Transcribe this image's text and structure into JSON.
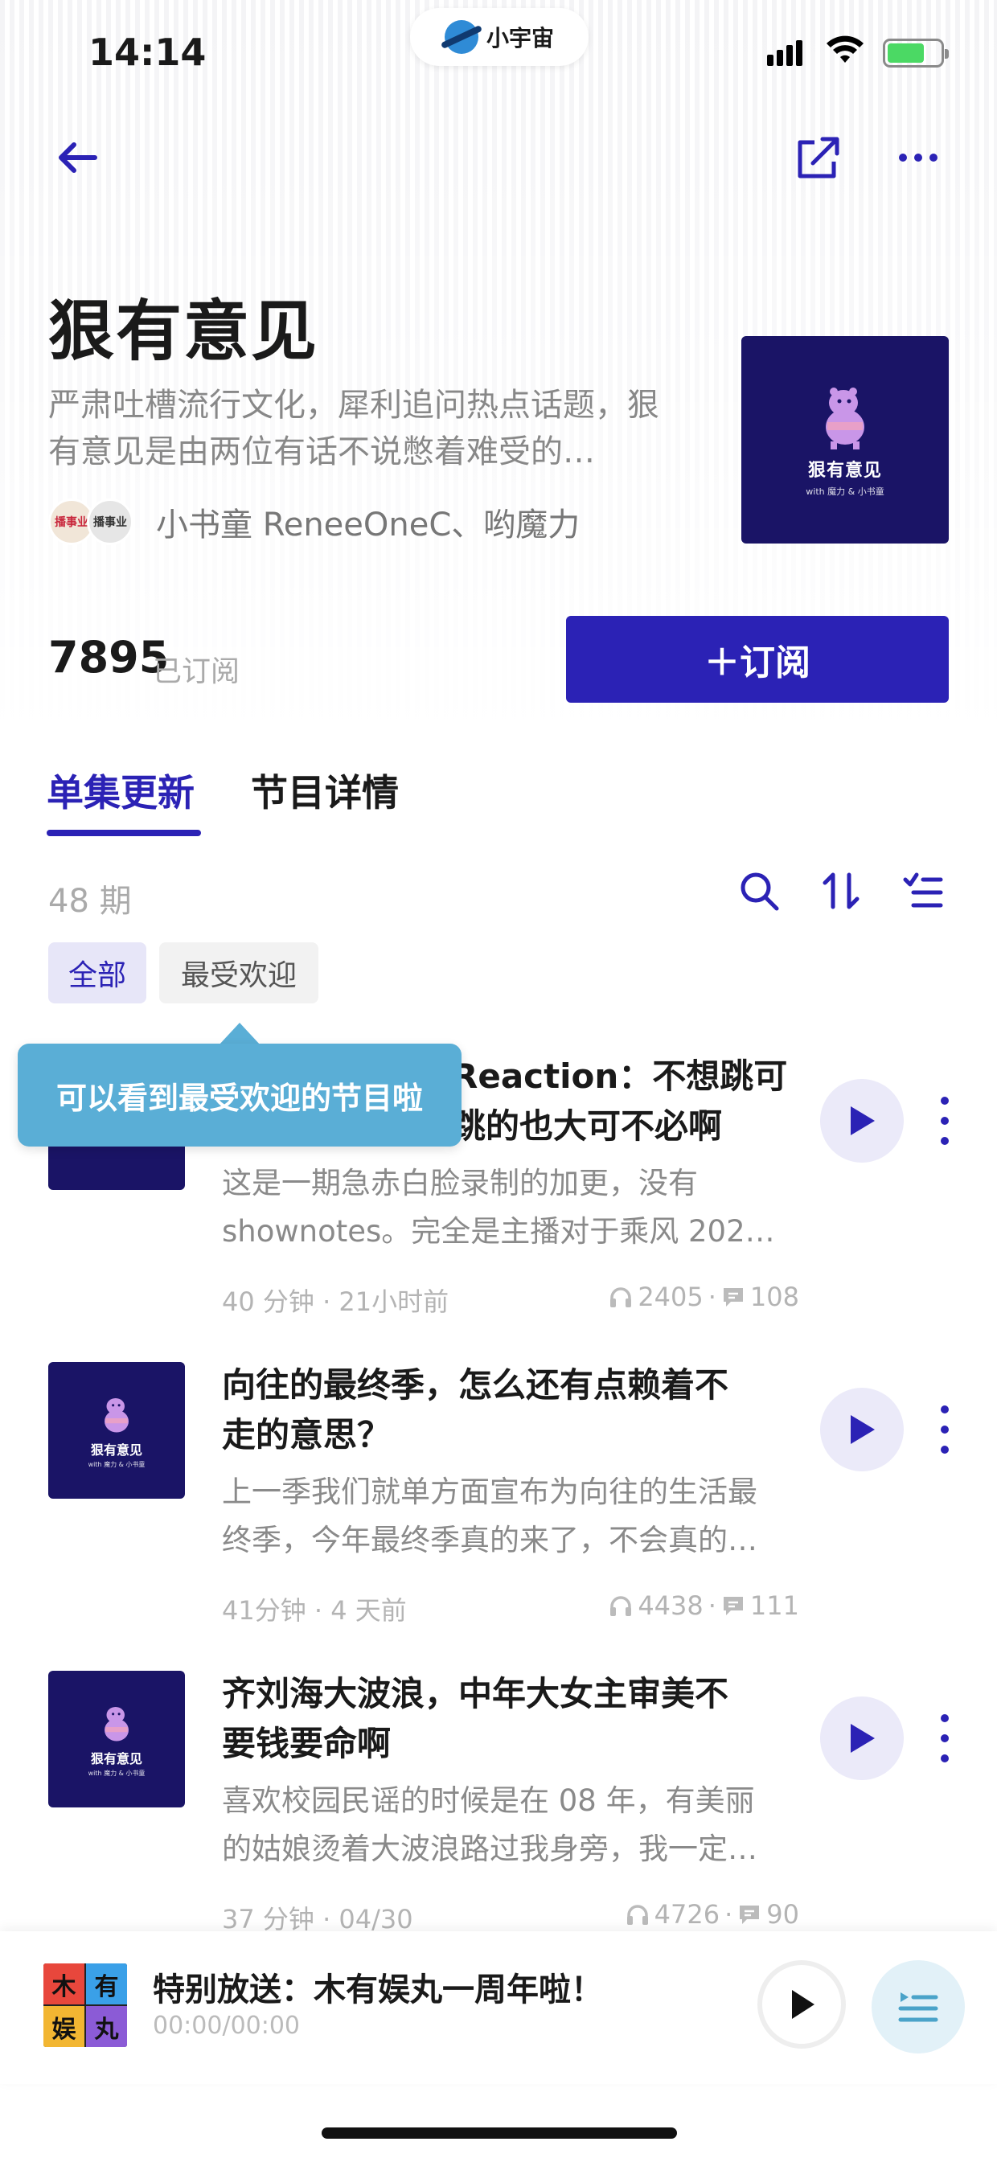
{
  "status": {
    "time": "14:14",
    "brand": "小宇宙"
  },
  "podcast": {
    "title": "狠有意见",
    "description": "严肃吐槽流行文化，犀利追问热点话题，狠有意见是由两位有话不说憋着难受的…",
    "authors": "小书童 ReneeOneC、哟魔力",
    "avatar1_label": "播事业",
    "avatar2_label": "播事业",
    "cover_title": "狠有意见",
    "cover_subtitle": "with 魔力 & 小书童"
  },
  "subscribe": {
    "count": "7895",
    "count_label": "已订阅",
    "button_label": "＋订阅"
  },
  "tabs": [
    {
      "label": "单集更新"
    },
    {
      "label": "节目详情"
    }
  ],
  "episode_count": "48 期",
  "filters": [
    {
      "label": "全部"
    },
    {
      "label": "最受欢迎"
    }
  ],
  "tooltip": "可以看到最受欢迎的节目啦",
  "episodes": [
    {
      "title_line1": "Reaction：不想跳可",
      "title_line2": "跳的也大可不必啊",
      "desc_line1": "这是一期急赤白脸录制的加更，没有",
      "desc_line2": "shownotes。完全是主播对于乘风 202…",
      "meta": "40 分钟 · 21小时前",
      "plays": "2405",
      "comments": "108"
    },
    {
      "title_line1": "向往的最终季，怎么还有点赖着不",
      "title_line2": "走的意思？",
      "desc_line1": "上一季我们就单方面宣布为向往的生活最",
      "desc_line2": "终季，今年最终季真的来了，不会真的…",
      "meta": "41分钟 · 4 天前",
      "plays": "4438",
      "comments": "111"
    },
    {
      "title_line1": "齐刘海大波浪，中年大女主审美不",
      "title_line2": "要钱要命啊",
      "desc_line1": "喜欢校园民谣的时候是在 08 年，有美丽",
      "desc_line2": "的姑娘烫着大波浪路过我身旁，我一定…",
      "meta": "37 分钟 · 04/30",
      "plays": "4726",
      "comments": "90"
    }
  ],
  "player": {
    "title": "特别放送：木有娱丸一周年啦！",
    "time": "00:00/00:00",
    "cover_chars": [
      "木",
      "有",
      "娱",
      "丸"
    ],
    "cover_colors": [
      "#e8473c",
      "#3aa0e8",
      "#f2b632",
      "#8b5bd6"
    ]
  },
  "colors": {
    "accent": "#2b22b5",
    "tooltip": "#5aaed6",
    "cover_bg": "#1a1466"
  }
}
